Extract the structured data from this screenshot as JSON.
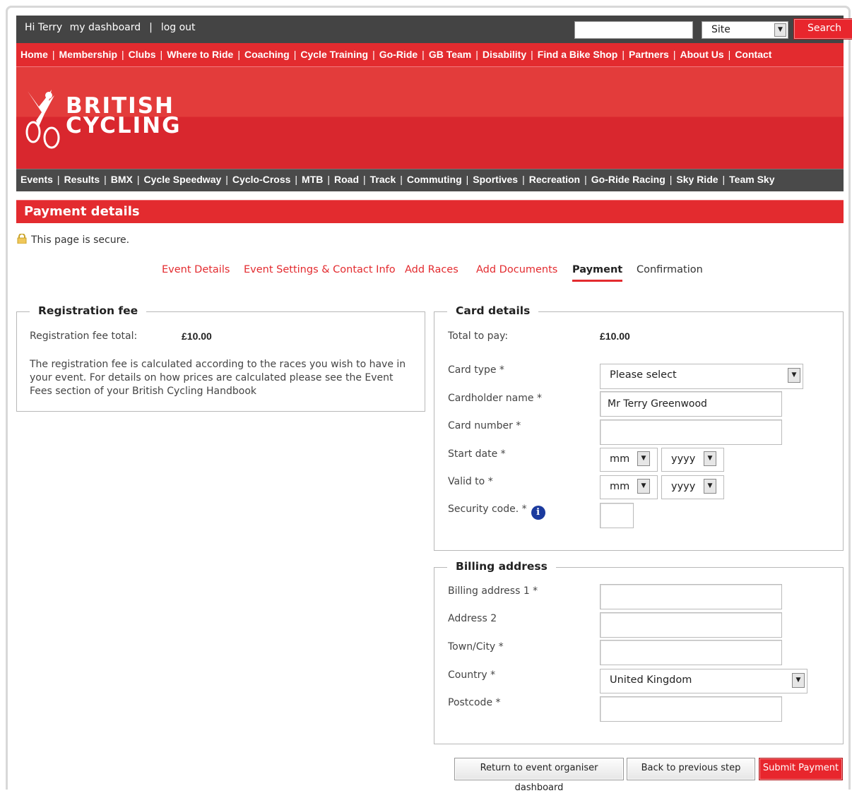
{
  "topbar": {
    "greeting": "Hi Terry",
    "dashboard_link": "my dashboard",
    "separator": "|",
    "logout_link": "log out",
    "search_value": "",
    "scope_select": "Site",
    "search_button": "Search"
  },
  "main_nav": [
    "Home",
    "Membership",
    "Clubs",
    "Where to Ride",
    "Coaching",
    "Cycle Training",
    "Go-Ride",
    "GB Team",
    "Disability",
    "Find a Bike Shop",
    "Partners",
    "About Us",
    "Contact"
  ],
  "logo": {
    "line1": "BRITISH",
    "line2": "CYCLING"
  },
  "sub_nav": [
    "Events",
    "Results",
    "BMX",
    "Cycle Speedway",
    "Cyclo-Cross",
    "MTB",
    "Road",
    "Track",
    "Commuting",
    "Sportives",
    "Recreation",
    "Go-Ride Racing",
    "Sky Ride",
    "Team Sky"
  ],
  "page_title": "Payment details",
  "secure_text": "This page is secure.",
  "steps": [
    {
      "label": "Event Details",
      "state": "link"
    },
    {
      "label": "Event Settings & Contact Info",
      "state": "link"
    },
    {
      "label": "Add Races",
      "state": "link"
    },
    {
      "label": "Add Documents",
      "state": "link"
    },
    {
      "label": "Payment",
      "state": "active"
    },
    {
      "label": "Confirmation",
      "state": "plain"
    }
  ],
  "registration_fee": {
    "legend": "Registration fee",
    "total_label": "Registration fee total:",
    "total_value": "£10.00",
    "description": "The registration fee is calculated according to the races you wish to have in your event. For details on how prices are calculated please see the Event Fees section of your British Cycling Handbook"
  },
  "card_details": {
    "legend": "Card details",
    "total_label": "Total to pay:",
    "total_value": "£10.00",
    "card_type_label": "Card type *",
    "card_type_value": "Please select",
    "cardholder_label": "Cardholder name *",
    "cardholder_value": "Mr Terry Greenwood",
    "card_number_label": "Card number *",
    "card_number_value": "",
    "start_date_label": "Start date *",
    "valid_to_label": "Valid to *",
    "month_placeholder": "mm",
    "year_placeholder": "yyyy",
    "security_label": "Security code. *",
    "security_value": ""
  },
  "billing": {
    "legend": "Billing address",
    "address1_label": "Billing address 1 *",
    "address2_label": "Address 2",
    "town_label": "Town/City *",
    "country_label": "Country *",
    "country_value": "United Kingdom",
    "postcode_label": "Postcode *"
  },
  "buttons": {
    "return": "Return to event organiser dashboard",
    "back": "Back to previous step",
    "submit": "Submit Payment"
  },
  "colors": {
    "brand_red": "#e32b2f",
    "dark_bar": "#444444",
    "info_blue": "#1b3a9e"
  }
}
